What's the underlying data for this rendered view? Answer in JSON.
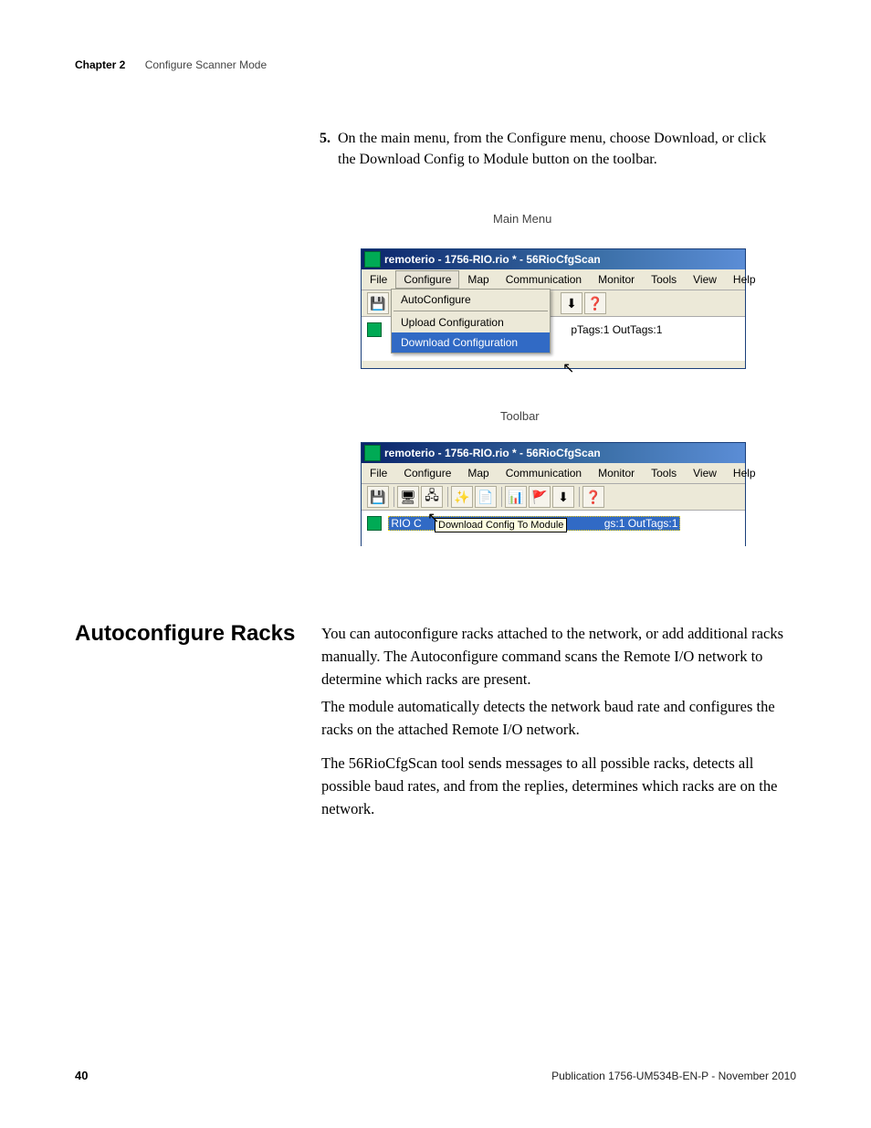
{
  "header": {
    "chapter": "Chapter 2",
    "title": "Configure Scanner Mode"
  },
  "step": {
    "num": "5.",
    "text": "On the main menu, from the Configure menu, choose Download, or click the Download Config to Module button on the toolbar."
  },
  "captions": {
    "main_menu": "Main Menu",
    "toolbar": "Toolbar"
  },
  "win_title": "remoterio - 1756-RIO.rio * - 56RioCfgScan",
  "menus": {
    "file": "File",
    "configure": "Configure",
    "map": "Map",
    "communication": "Communication",
    "monitor": "Monitor",
    "tools": "Tools",
    "view": "View",
    "help": "Help"
  },
  "dropdown": {
    "auto": "AutoConfigure",
    "upload": "Upload Configuration",
    "download": "Download Configuration"
  },
  "tree1_text": "pTags:1 OutTags:1",
  "tree2_text_a": "RIO C",
  "tree2_text_b": "gs:1 OutTags:1",
  "tooltip": "Download Config To Module",
  "section_heading": "Autoconfigure Racks",
  "paras": {
    "p1": "You can autoconfigure racks attached to the network, or add additional racks manually. The Autoconfigure command scans the Remote I/O network to determine which racks are present.",
    "p2": "The module automatically detects the network baud rate and configures the racks on the attached Remote I/O network.",
    "p3": "The 56RioCfgScan tool sends messages to all possible racks, detects all possible baud rates, and from the replies, determines which racks are on the network."
  },
  "footer": {
    "page": "40",
    "pub": "Publication 1756-UM534B-EN-P - November 2010"
  },
  "icons": {
    "save": "💾",
    "connect1": "🖥",
    "connect2": "🖧",
    "wand": "✨",
    "doc": "📄",
    "bar": "📊",
    "flag": "🚩",
    "dl": "⬇",
    "help": "❓"
  }
}
